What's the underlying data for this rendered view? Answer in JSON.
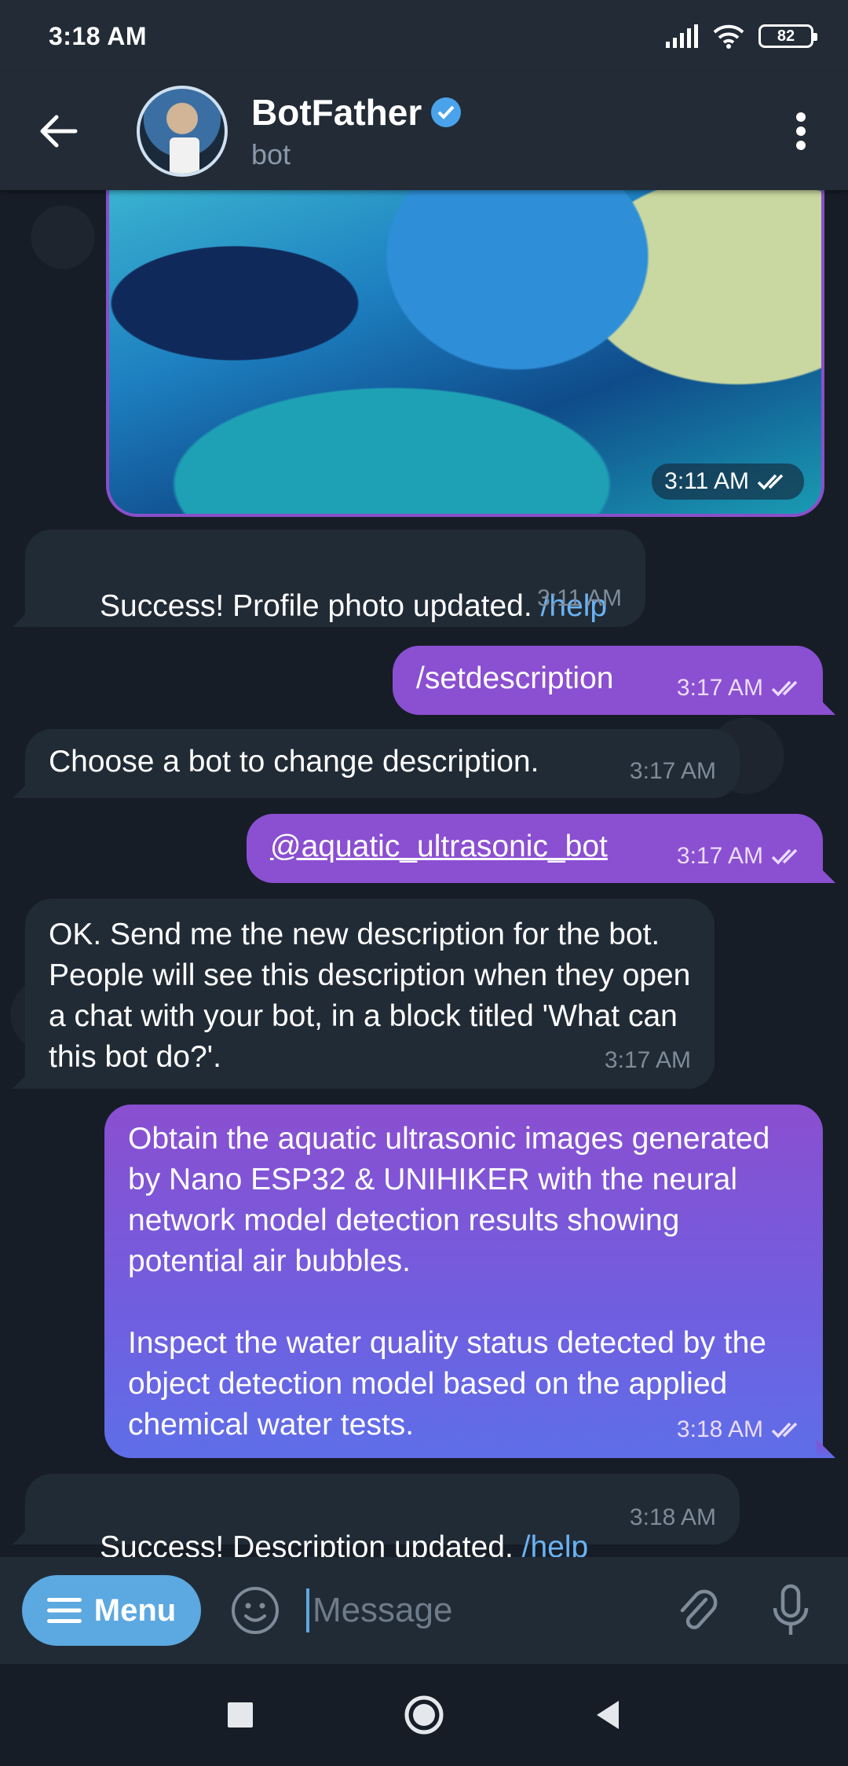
{
  "status_bar": {
    "time": "3:18 AM",
    "battery": "82"
  },
  "header": {
    "title": "BotFather",
    "subtitle": "bot"
  },
  "photo": {
    "time": "3:11 AM"
  },
  "messages": [
    {
      "text": "Success! Profile photo updated. ",
      "link": "/help",
      "time": "3:11 AM"
    },
    {
      "text": "/setdescription",
      "time": "3:17 AM"
    },
    {
      "text": "Choose a bot to change description.",
      "time": "3:17 AM"
    },
    {
      "text": "@aquatic_ultrasonic_bot",
      "time": "3:17 AM"
    },
    {
      "text": "OK. Send me the new description for the bot. People will see this description when they open a chat with your bot, in a block titled 'What can this bot do?'.",
      "time": "3:17 AM"
    },
    {
      "text": "Obtain the aquatic ultrasonic images generated by Nano ESP32 & UNIHIKER with the neural network model detection results showing potential air bubbles.\n\nInspect the water quality status detected by the object detection model based on the applied chemical water tests.",
      "time": "3:18 AM"
    },
    {
      "text": "Success! Description updated. ",
      "link": "/help",
      "time": "3:18 AM"
    }
  ],
  "composer": {
    "menu_label": "Menu",
    "placeholder": "Message"
  },
  "colors": {
    "accent": "#5ca8e0",
    "outgoing_bubble": "#8b4fd1",
    "incoming_bubble": "#212b36",
    "link": "#6ab3f3"
  }
}
